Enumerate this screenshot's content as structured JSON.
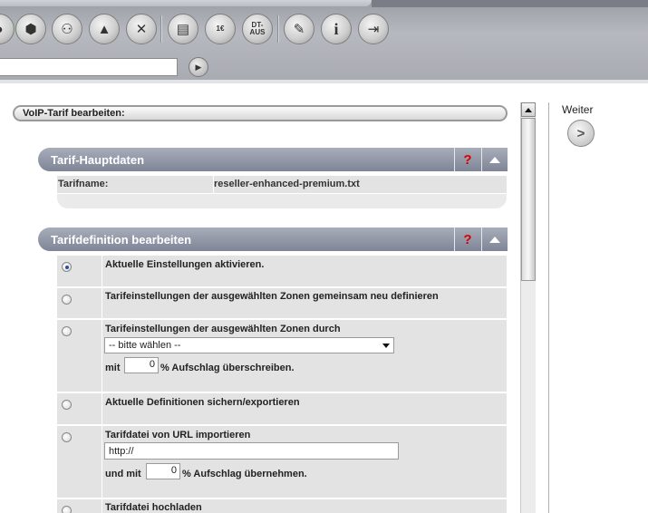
{
  "toolbar": {
    "buttons": [
      {
        "name": "toolbar-btn-partial",
        "icon": "◑"
      },
      {
        "name": "toolbar-btn-box",
        "icon": "⬢"
      },
      {
        "name": "toolbar-btn-group",
        "icon": "⚇"
      },
      {
        "name": "toolbar-btn-pyramid",
        "icon": "▲"
      },
      {
        "name": "toolbar-btn-xx",
        "icon": "✕"
      },
      {
        "name": "toolbar-btn-document",
        "icon": "▤"
      },
      {
        "name": "toolbar-btn-invoice",
        "icon": "1€"
      },
      {
        "name": "toolbar-btn-dtaus",
        "icon": "DT-\nAUS"
      },
      {
        "name": "toolbar-btn-tools",
        "icon": "✎"
      },
      {
        "name": "toolbar-btn-info",
        "icon": "i"
      },
      {
        "name": "toolbar-btn-exit",
        "icon": "⇥"
      }
    ],
    "invoice_label": "1€",
    "dtaus_line1": "DT-",
    "dtaus_line2": "AUS",
    "search_value": ""
  },
  "header": {
    "title": "VoIP-Tarif bearbeiten:"
  },
  "panel_main": {
    "title": "Tarif-Hauptdaten",
    "help": "?",
    "tariff_name_label": "Tarifname:",
    "tariff_name_value": "reseller-enhanced-premium.txt"
  },
  "panel_def": {
    "title": "Tarifdefinition bearbeiten",
    "help": "?",
    "options": [
      {
        "label": "Aktuelle Einstellungen aktivieren.",
        "checked": true
      },
      {
        "label": "Tarifeinstellungen der ausgewählten Zonen gemeinsam neu definieren",
        "checked": false
      },
      {
        "label": "Tarifeinstellungen der ausgewählten Zonen durch",
        "checked": false,
        "select_value": "-- bitte wählen --",
        "mit_label": "mit",
        "percent_value": "0",
        "suffix": "% Aufschlag überschreiben."
      },
      {
        "label": "Aktuelle Definitionen sichern/exportieren",
        "checked": false
      },
      {
        "label": "Tarifdatei von URL importieren",
        "checked": false,
        "url_value": "http://",
        "mit_label": "und mit",
        "percent_value": "0",
        "suffix": "% Aufschlag übernehmen."
      },
      {
        "label": "Tarifdatei hochladen",
        "checked": false
      }
    ]
  },
  "sidebar": {
    "next_label": "Weiter",
    "next_icon": "chevron-right-icon"
  }
}
